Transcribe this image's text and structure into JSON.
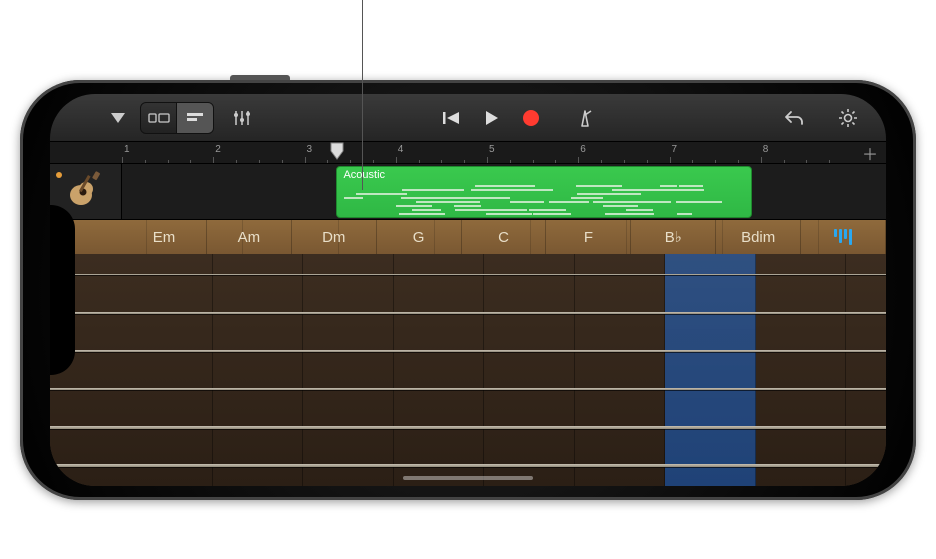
{
  "callout": {
    "target": "recorded-region"
  },
  "toolbar": {
    "menu": "menu",
    "browser": "browser",
    "tracks": "tracks-view",
    "mixer": "mixer",
    "rewind": "go-to-beginning",
    "play": "play",
    "record": "record",
    "metronome": "metronome",
    "undo": "undo",
    "settings": "settings"
  },
  "ruler": {
    "bars": [
      "1",
      "2",
      "3",
      "4",
      "5",
      "6",
      "7",
      "8"
    ],
    "playhead_bar": 3.35
  },
  "track": {
    "instrument": "acoustic-guitar",
    "muted": true,
    "region": {
      "name": "Acoustic",
      "start_bar": 3.35,
      "end_bar": 7.9,
      "color": "#3ac94e"
    }
  },
  "instrument_panel": {
    "chords": [
      "Em",
      "Am",
      "Dm",
      "G",
      "C",
      "F",
      "B♭",
      "Bdim"
    ],
    "pressed_index": 6,
    "strings": 6,
    "autoplay_on": false
  }
}
